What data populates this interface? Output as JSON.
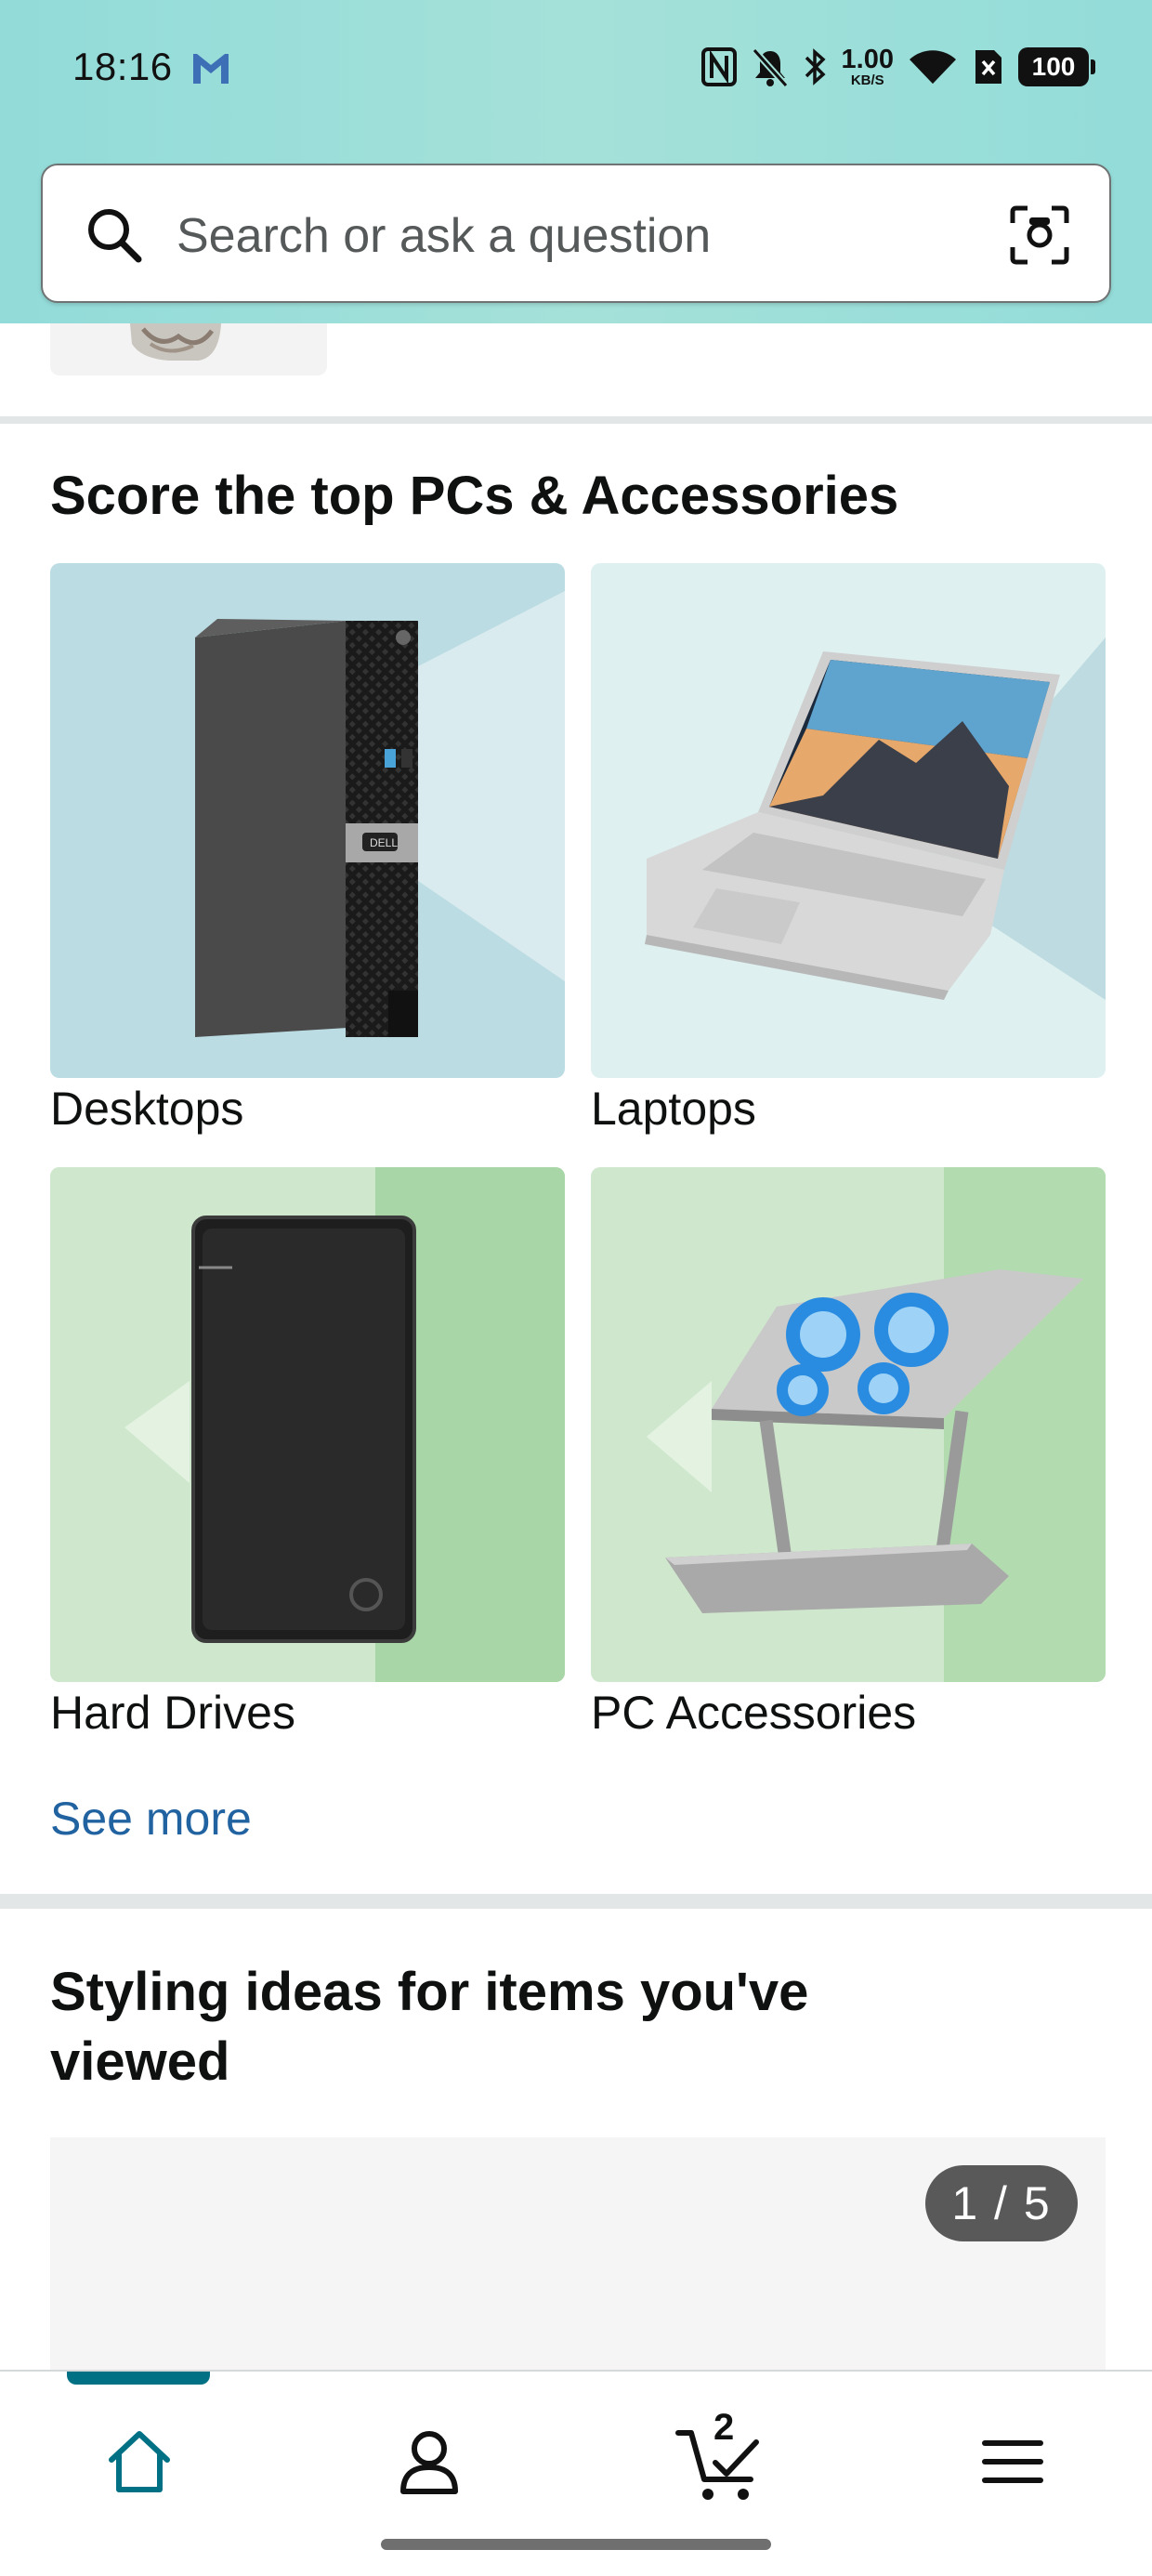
{
  "status_bar": {
    "time": "18:16",
    "network_speed": "1.00",
    "network_unit": "KB/S",
    "battery": "100",
    "icons": [
      "gmail-icon",
      "nfc-icon",
      "bell-muted-icon",
      "bluetooth-icon",
      "wifi-icon",
      "sim-x-icon",
      "battery-icon"
    ]
  },
  "search": {
    "placeholder": "Search or ask a question",
    "icon": "search-icon",
    "camera_icon": "camera-scan-icon"
  },
  "pcs_section": {
    "title": "Score the top PCs & Accessories",
    "tiles": [
      {
        "label": "Desktops",
        "image": "desktop-tower-image"
      },
      {
        "label": "Laptops",
        "image": "laptop-image"
      },
      {
        "label": "Hard Drives",
        "image": "external-hard-drive-image"
      },
      {
        "label": "PC Accessories",
        "image": "laptop-stand-image"
      }
    ],
    "see_more": "See more"
  },
  "styling_section": {
    "title": "Styling ideas for items you've viewed",
    "pager": "1 / 5"
  },
  "bottom_nav": {
    "items": [
      {
        "name": "home",
        "icon": "home-icon",
        "active": true
      },
      {
        "name": "account",
        "icon": "person-icon",
        "active": false
      },
      {
        "name": "cart",
        "icon": "cart-icon",
        "active": false,
        "count": "2"
      },
      {
        "name": "menu",
        "icon": "hamburger-menu-icon",
        "active": false
      }
    ]
  },
  "colors": {
    "header_gradient": "#92dbd9",
    "link": "#2162a1",
    "active_nav": "#007185",
    "pager_bg": "#595959"
  }
}
